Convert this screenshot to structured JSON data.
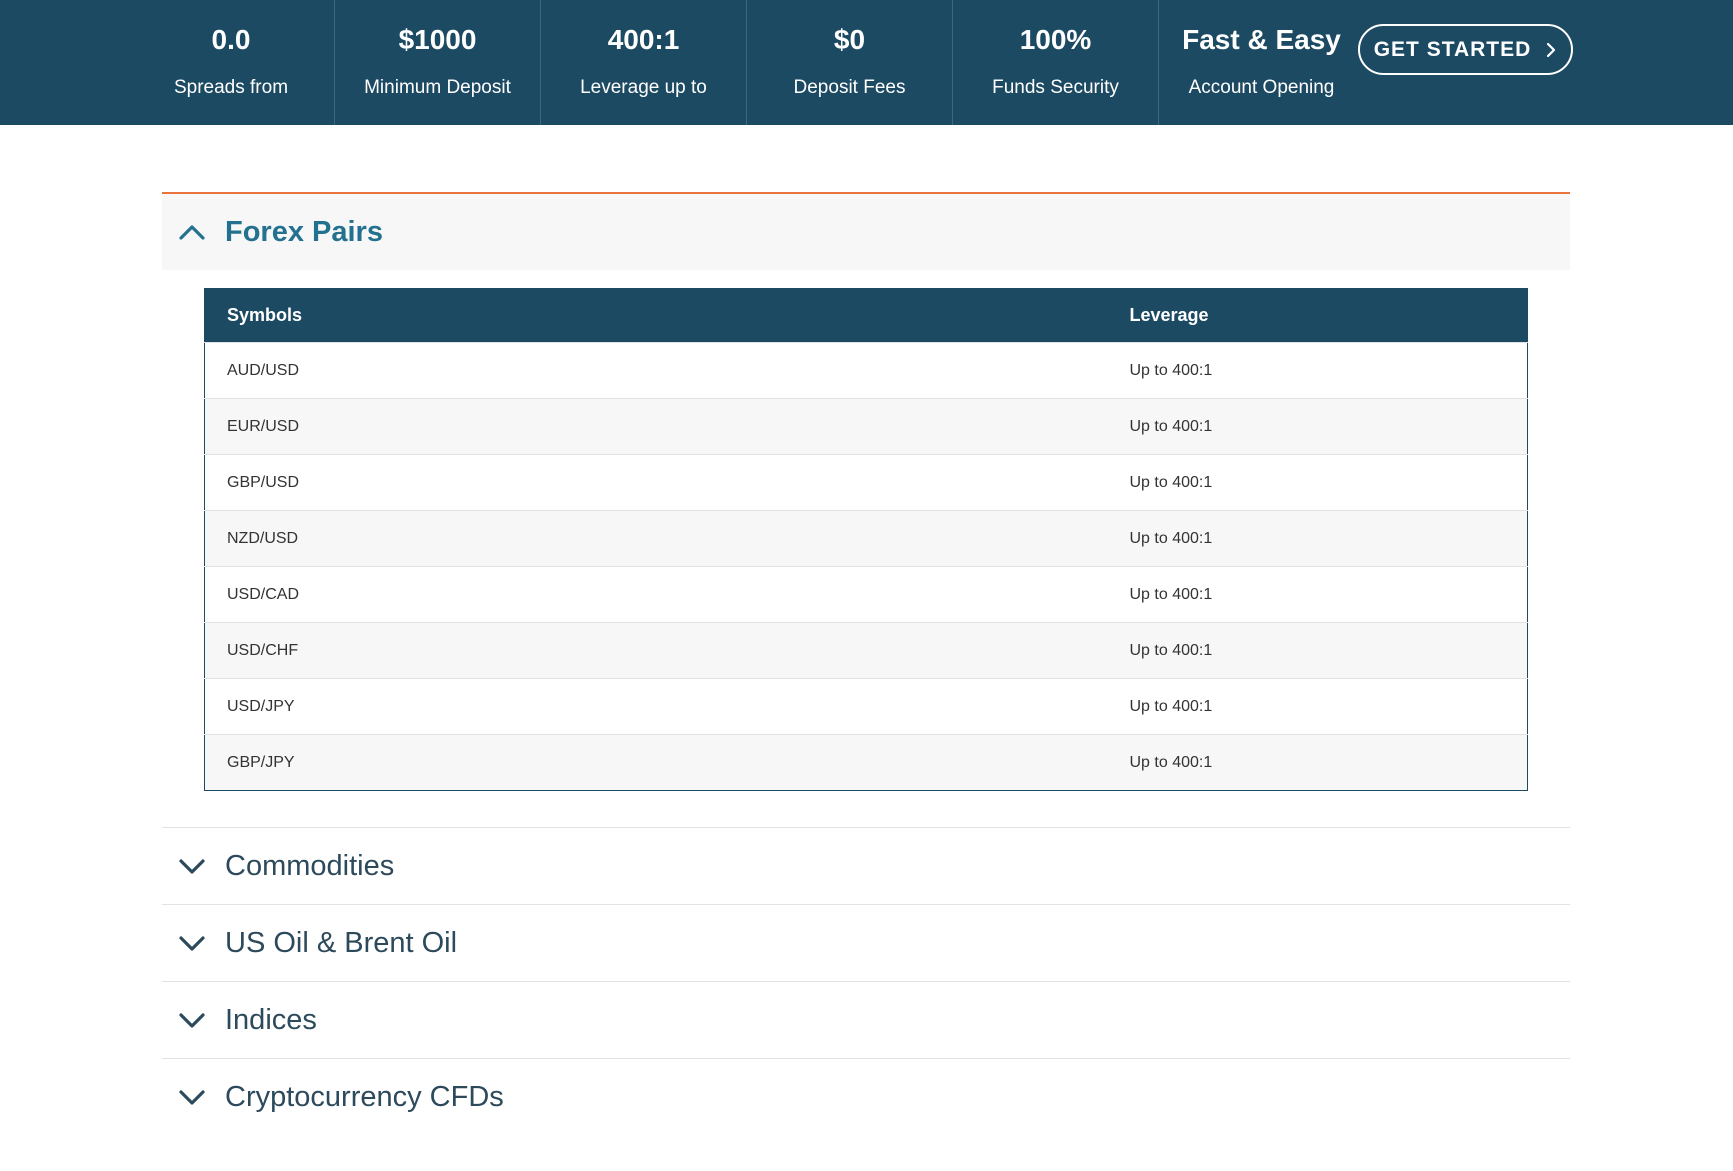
{
  "stats": [
    {
      "value": "0.0",
      "label": "Spreads from"
    },
    {
      "value": "$1000",
      "label": "Minimum Deposit"
    },
    {
      "value": "400:1",
      "label": "Leverage up to"
    },
    {
      "value": "$0",
      "label": "Deposit Fees"
    },
    {
      "value": "100%",
      "label": "Funds Security"
    },
    {
      "value": "Fast & Easy",
      "label": "Account Opening"
    }
  ],
  "cta": {
    "label": "GET STARTED"
  },
  "accordion": {
    "open_section": {
      "title": "Forex Pairs",
      "table": {
        "headers": [
          "Symbols",
          "Leverage"
        ],
        "rows": [
          [
            "AUD/USD",
            "Up to 400:1"
          ],
          [
            "EUR/USD",
            "Up to 400:1"
          ],
          [
            "GBP/USD",
            "Up to 400:1"
          ],
          [
            "NZD/USD",
            "Up to 400:1"
          ],
          [
            "USD/CAD",
            "Up to 400:1"
          ],
          [
            "USD/CHF",
            "Up to 400:1"
          ],
          [
            "USD/JPY",
            "Up to 400:1"
          ],
          [
            "GBP/JPY",
            "Up to 400:1"
          ]
        ]
      }
    },
    "collapsed_sections": [
      {
        "title": "Commodities"
      },
      {
        "title": "US Oil & Brent Oil"
      },
      {
        "title": "Indices"
      },
      {
        "title": "Cryptocurrency CFDs"
      }
    ]
  },
  "colors": {
    "header_bg": "#1d4a63",
    "accent_orange": "#e8743b",
    "open_title": "#23718f",
    "collapsed_title": "#2d4a5c"
  },
  "icons": {
    "open": "chevron-up-icon",
    "collapsed": "chevron-down-icon",
    "cta": "chevron-right-icon"
  }
}
